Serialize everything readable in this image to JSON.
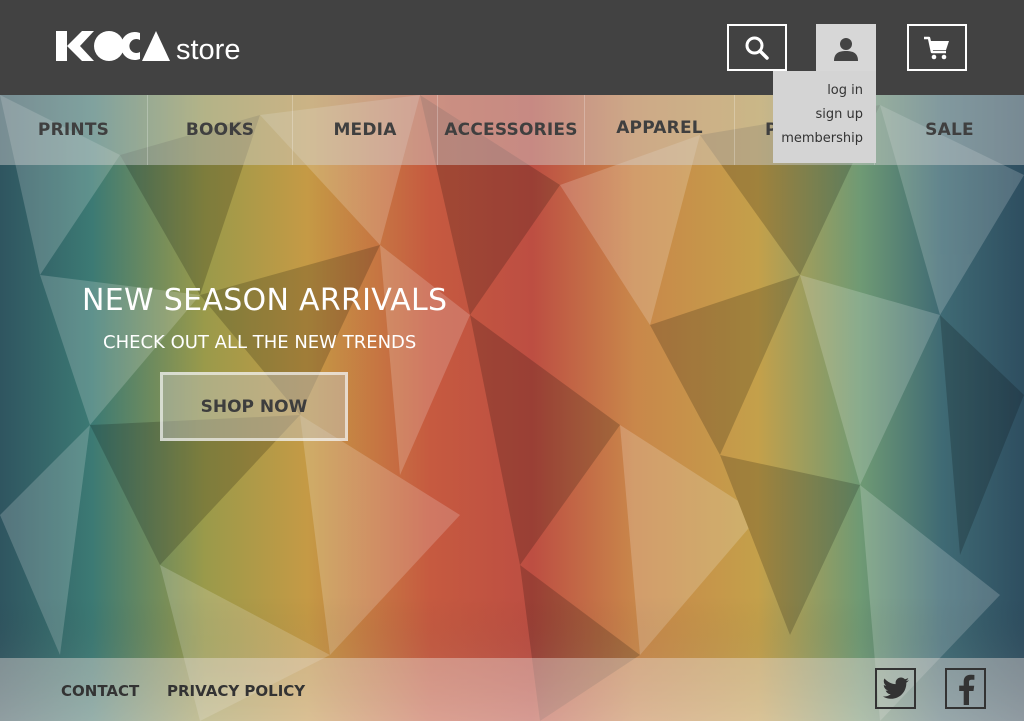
{
  "brand": {
    "logo_text": "KOCA",
    "store_label": "store"
  },
  "header": {
    "search_icon": "search-icon",
    "user_icon": "user-icon",
    "cart_icon": "cart-icon"
  },
  "user_menu": {
    "items": [
      "log in",
      "sign up",
      "membership"
    ]
  },
  "nav": {
    "items": [
      "PRINTS",
      "BOOKS",
      "MEDIA",
      "ACCESSORIES",
      "APPAREL",
      "P",
      "SALE"
    ]
  },
  "hero": {
    "title": "NEW SEASON ARRIVALS",
    "subtitle": "CHECK OUT ALL THE NEW TRENDS",
    "cta_label": "SHOP NOW"
  },
  "footer": {
    "links": [
      "CONTACT",
      "PRIVACY POLICY"
    ],
    "social": [
      "twitter-icon",
      "facebook-icon"
    ]
  },
  "colors": {
    "header_bg": "#424242",
    "dropdown_bg": "#d4d4d4",
    "text_dark": "#3f3f3f",
    "text_light": "#ffffff"
  }
}
